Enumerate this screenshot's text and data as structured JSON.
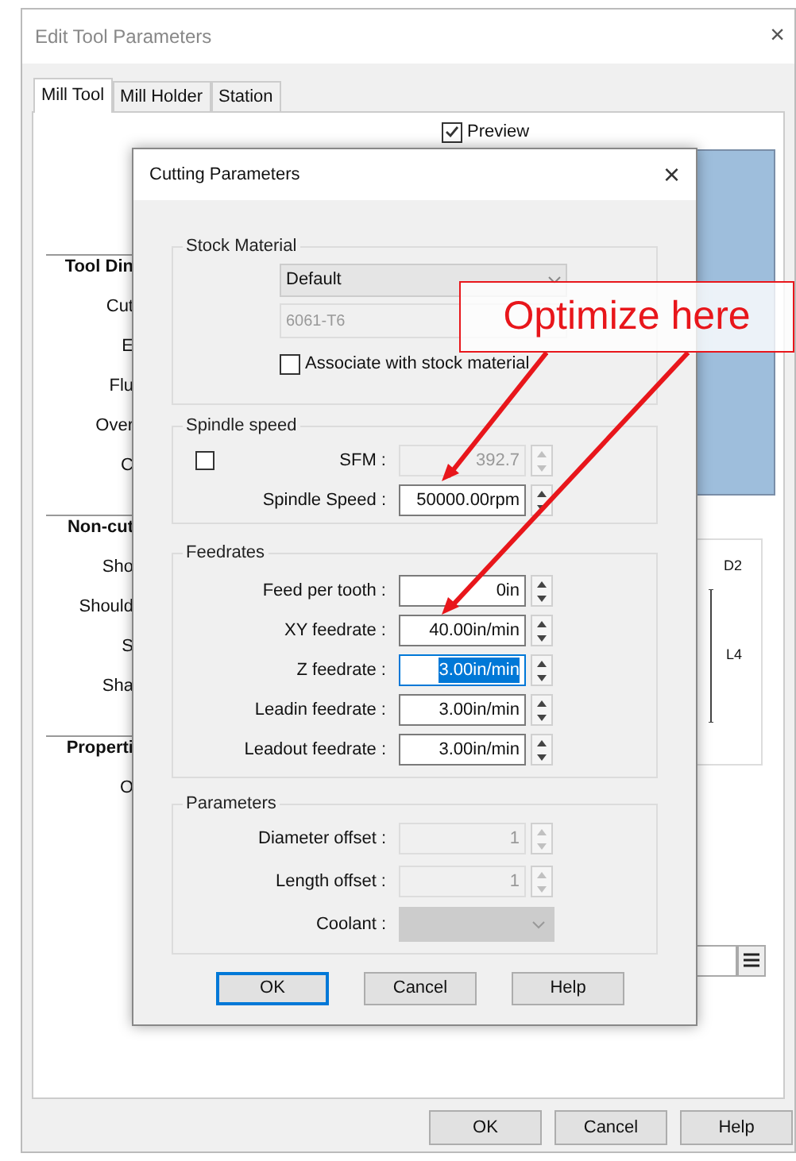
{
  "window": {
    "title": "Edit Tool Parameters",
    "close": "×"
  },
  "tabs": [
    {
      "label": "Mill Tool",
      "selected": true
    },
    {
      "label": "Mill Holder",
      "selected": false
    },
    {
      "label": "Station",
      "selected": false
    }
  ],
  "preview": {
    "label": "Preview",
    "checked": true
  },
  "background_sections": [
    {
      "heading": "Tool Din",
      "labels": [
        "Cut",
        "E",
        "Flu",
        "Over",
        "C"
      ]
    },
    {
      "heading": "Non-cut",
      "labels": [
        "Sho",
        "Should",
        "S",
        "Sha"
      ]
    },
    {
      "heading": "Properti",
      "labels": [
        "O"
      ]
    }
  ],
  "diagram_labels": [
    "D2",
    "L4"
  ],
  "buttons": [
    {
      "label": "OK"
    },
    {
      "label": "Cancel"
    },
    {
      "label": "Help"
    }
  ],
  "dialog": {
    "title": "Cutting Parameters",
    "close": "×",
    "stock_material": {
      "title": "Stock Material",
      "material": "Default",
      "grade": "6061-T6",
      "associate": {
        "label": "Associate with stock material",
        "checked": false
      }
    },
    "spindle_speed": {
      "title": "Spindle speed",
      "override": {
        "checked": false
      },
      "fields": [
        {
          "label": "SFM :",
          "value": "392.7",
          "disabled": true
        },
        {
          "label": "Spindle Speed :",
          "value": "50000.00rpm",
          "disabled": false
        }
      ]
    },
    "feedrates": {
      "title": "Feedrates",
      "fields": [
        {
          "label": "Feed per tooth :",
          "value": "0in",
          "focused": false
        },
        {
          "label": "XY feedrate :",
          "value": "40.00in/min",
          "focused": false
        },
        {
          "label": "Z feedrate :",
          "value": "3.00in/min",
          "focused": true
        },
        {
          "label": "Leadin feedrate :",
          "value": "3.00in/min",
          "focused": false
        },
        {
          "label": "Leadout feedrate :",
          "value": "3.00in/min",
          "focused": false
        }
      ]
    },
    "parameters": {
      "title": "Parameters",
      "fields": [
        {
          "label": "Diameter offset :",
          "value": "1",
          "kind": "spin",
          "disabled": true
        },
        {
          "label": "Length offset :",
          "value": "1",
          "kind": "spin",
          "disabled": true
        },
        {
          "label": "Coolant :",
          "kind": "dropdown",
          "disabled": true
        }
      ]
    },
    "buttons": [
      {
        "label": "OK",
        "default": true
      },
      {
        "label": "Cancel",
        "default": false
      },
      {
        "label": "Help",
        "default": false
      }
    ]
  },
  "annotation": {
    "text": "Optimize here"
  }
}
